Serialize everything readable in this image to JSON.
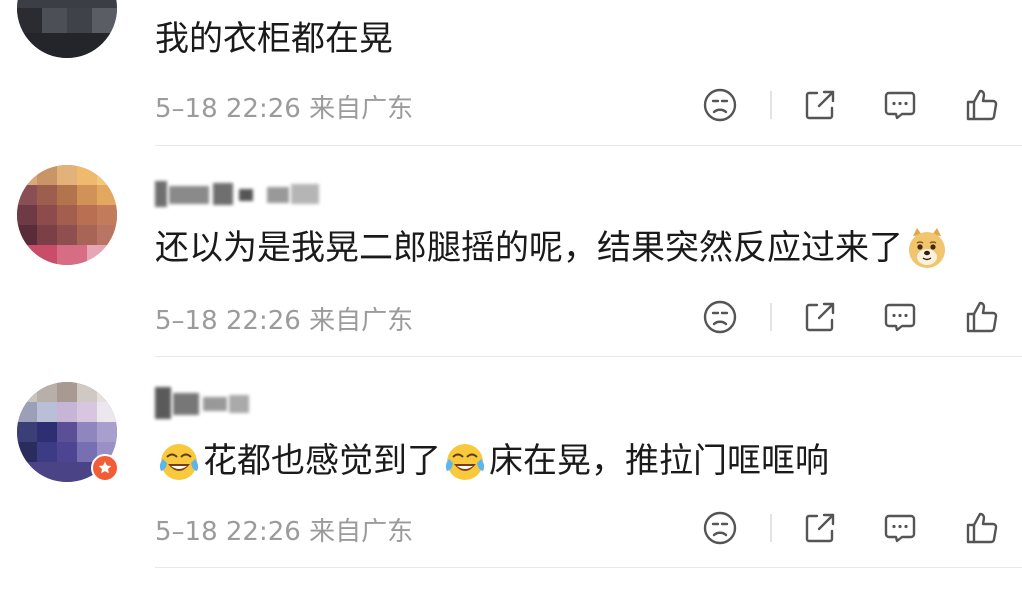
{
  "comments": [
    {
      "username": "",
      "text": "我的衣柜都在晃",
      "meta": "5–18 22:26 来自广东"
    },
    {
      "username": "",
      "text": "还以为是我晃二郎腿摇的呢，结果突然反应过来了",
      "meta": "5–18 22:26 来自广东"
    },
    {
      "username": "",
      "text_part1": "花都也感觉到了",
      "text_part2": "床在晃，推拉门哐哐响",
      "meta": "5–18 22:26 来自广东"
    }
  ],
  "icons": {
    "dislike": "sad-face-icon",
    "share": "share-icon",
    "reply": "comment-icon",
    "like": "thumbs-up-icon",
    "emoji_doge": "doge-emoji-icon",
    "emoji_laugh_cry": "laugh-cry-emoji-icon",
    "verified": "verified-badge-icon"
  },
  "colors": {
    "text": "#1a1a1a",
    "meta": "#9b9b9b",
    "icon": "#555555",
    "badge": "#f25c36"
  }
}
